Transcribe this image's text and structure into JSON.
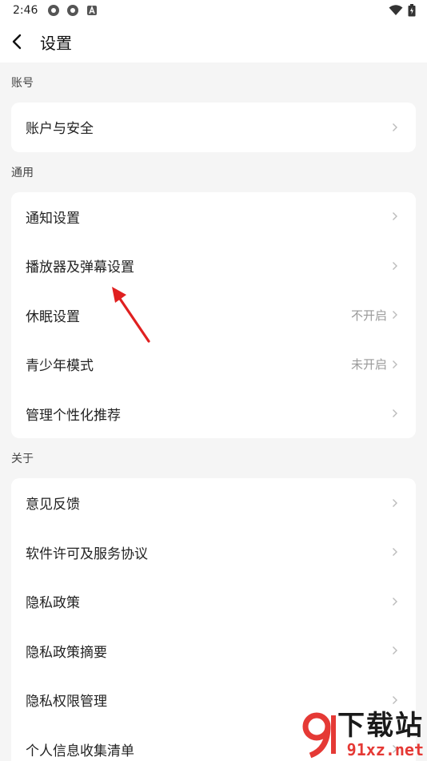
{
  "status_bar": {
    "time": "2:46"
  },
  "header": {
    "title": "设置"
  },
  "sections": [
    {
      "label": "账号",
      "items": [
        {
          "label": "账户与安全",
          "value": ""
        }
      ]
    },
    {
      "label": "通用",
      "items": [
        {
          "label": "通知设置",
          "value": ""
        },
        {
          "label": "播放器及弹幕设置",
          "value": ""
        },
        {
          "label": "休眠设置",
          "value": "不开启"
        },
        {
          "label": "青少年模式",
          "value": "未开启"
        },
        {
          "label": "管理个性化推荐",
          "value": ""
        }
      ]
    },
    {
      "label": "关于",
      "items": [
        {
          "label": "意见反馈",
          "value": ""
        },
        {
          "label": "软件许可及服务协议",
          "value": ""
        },
        {
          "label": "隐私政策",
          "value": ""
        },
        {
          "label": "隐私政策摘要",
          "value": ""
        },
        {
          "label": "隐私权限管理",
          "value": ""
        },
        {
          "label": "个人信息收集清单",
          "value": ""
        }
      ]
    }
  ],
  "watermark": {
    "brand": "下载站",
    "domain": "91xz.net"
  },
  "colors": {
    "arrow": "#e02020",
    "watermark_red": "#e53935"
  }
}
